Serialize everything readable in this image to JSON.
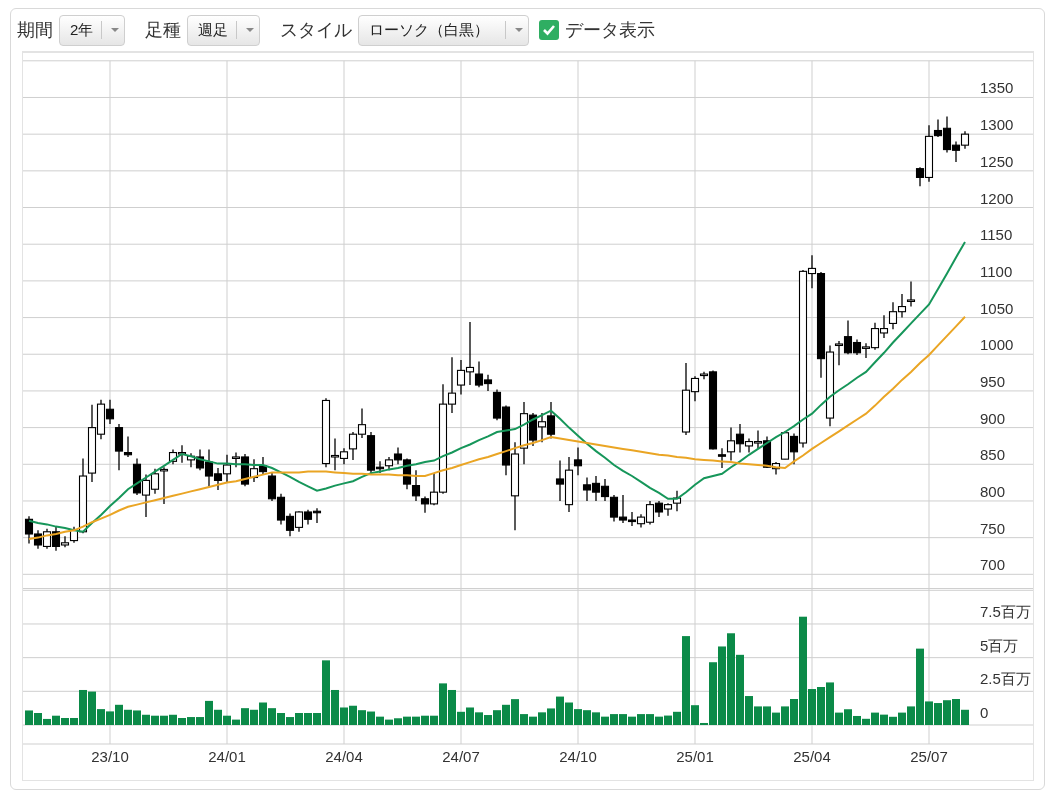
{
  "toolbar": {
    "fields": [
      {
        "label": "期間",
        "value": "2年"
      },
      {
        "label": "足種",
        "value": "週足"
      },
      {
        "label": "スタイル",
        "value": "ローソク（白黒）"
      }
    ],
    "data_display": {
      "label": "データ表示",
      "checked": true
    }
  },
  "price_chart": {
    "chart_data": {
      "type": "candlestick",
      "grid": true,
      "ylim": [
        680,
        1412
      ],
      "categories": [
        null,
        null,
        null,
        null,
        null,
        null,
        null,
        null,
        null,
        null,
        null,
        null,
        null,
        null,
        null,
        null,
        null,
        null,
        null,
        null,
        null,
        null,
        null,
        null,
        null,
        null,
        null,
        null,
        null,
        null,
        null,
        null,
        null,
        null,
        null,
        null,
        null,
        null,
        null,
        null,
        null,
        null,
        null,
        null,
        null,
        null,
        null,
        null,
        null,
        null,
        null,
        null,
        null,
        null,
        null,
        null,
        null,
        null,
        null,
        null,
        null,
        null,
        null,
        null,
        null,
        null,
        null,
        null,
        null,
        null,
        null,
        null,
        null,
        null,
        null,
        null,
        null,
        null,
        null,
        null,
        null,
        null,
        null,
        null,
        null,
        null,
        null,
        null,
        null,
        null,
        null,
        null,
        null,
        null,
        null,
        null,
        null,
        null,
        null,
        null,
        null,
        null,
        null,
        null,
        null
      ],
      "yticks": [
        700,
        750,
        800,
        850,
        900,
        950,
        1000,
        1050,
        1100,
        1150,
        1200,
        1250,
        1300,
        1350
      ],
      "ohlc": [
        [
          775,
          779,
          742,
          755
        ],
        [
          755,
          760,
          735,
          740
        ],
        [
          738,
          762,
          735,
          758
        ],
        [
          758,
          765,
          732,
          738
        ],
        [
          740,
          752,
          737,
          743
        ],
        [
          746,
          765,
          743,
          760
        ],
        [
          758,
          858,
          756,
          834
        ],
        [
          838,
          931,
          826,
          900
        ],
        [
          891,
          938,
          884,
          932
        ],
        [
          925,
          938,
          905,
          912
        ],
        [
          900,
          905,
          842,
          868
        ],
        [
          866,
          888,
          860,
          863
        ],
        [
          850,
          858,
          808,
          811
        ],
        [
          808,
          836,
          778,
          828
        ],
        [
          816,
          844,
          810,
          837
        ],
        [
          842,
          846,
          796,
          843
        ],
        [
          854,
          870,
          850,
          866
        ],
        [
          865,
          876,
          852,
          866
        ],
        [
          856,
          865,
          846,
          861
        ],
        [
          860,
          870,
          842,
          845
        ],
        [
          853,
          870,
          820,
          834
        ],
        [
          837,
          845,
          815,
          828
        ],
        [
          837,
          863,
          826,
          849
        ],
        [
          859,
          866,
          846,
          860
        ],
        [
          860,
          864,
          820,
          823
        ],
        [
          832,
          857,
          826,
          844
        ],
        [
          848,
          860,
          836,
          840
        ],
        [
          834,
          838,
          800,
          803
        ],
        [
          805,
          810,
          768,
          774
        ],
        [
          779,
          783,
          752,
          760
        ],
        [
          764,
          786,
          758,
          785
        ],
        [
          785,
          788,
          768,
          775
        ],
        [
          786,
          790,
          770,
          785
        ],
        [
          851,
          940,
          846,
          937
        ],
        [
          860,
          885,
          842,
          862
        ],
        [
          858,
          872,
          850,
          867
        ],
        [
          871,
          894,
          856,
          891
        ],
        [
          891,
          926,
          886,
          904
        ],
        [
          889,
          894,
          836,
          842
        ],
        [
          846,
          854,
          838,
          845
        ],
        [
          848,
          860,
          842,
          856
        ],
        [
          864,
          873,
          850,
          856
        ],
        [
          856,
          858,
          816,
          823
        ],
        [
          821,
          842,
          800,
          807
        ],
        [
          803,
          806,
          784,
          796
        ],
        [
          796,
          838,
          794,
          812
        ],
        [
          812,
          959,
          810,
          932
        ],
        [
          932,
          996,
          920,
          947
        ],
        [
          958,
          992,
          945,
          978
        ],
        [
          976,
          1044,
          958,
          982
        ],
        [
          973,
          990,
          955,
          958
        ],
        [
          965,
          972,
          950,
          960
        ],
        [
          948,
          952,
          910,
          913
        ],
        [
          928,
          930,
          835,
          849
        ],
        [
          807,
          880,
          760,
          864
        ],
        [
          872,
          935,
          850,
          919
        ],
        [
          917,
          920,
          875,
          883
        ],
        [
          901,
          920,
          880,
          908
        ],
        [
          916,
          935,
          885,
          891
        ],
        [
          830,
          855,
          800,
          823
        ],
        [
          795,
          860,
          785,
          842
        ],
        [
          856,
          873,
          835,
          848
        ],
        [
          822,
          832,
          800,
          815
        ],
        [
          824,
          834,
          800,
          812
        ],
        [
          820,
          830,
          800,
          806
        ],
        [
          805,
          808,
          772,
          778
        ],
        [
          778,
          808,
          770,
          774
        ],
        [
          774,
          785,
          766,
          773
        ],
        [
          769,
          782,
          764,
          778
        ],
        [
          771,
          800,
          768,
          795
        ],
        [
          797,
          800,
          778,
          785
        ],
        [
          789,
          797,
          780,
          795
        ],
        [
          797,
          814,
          786,
          804
        ],
        [
          894,
          988,
          890,
          951
        ],
        [
          949,
          970,
          936,
          967
        ],
        [
          971,
          976,
          966,
          973
        ],
        [
          976,
          978,
          870,
          871
        ],
        [
          863,
          872,
          845,
          862
        ],
        [
          867,
          900,
          855,
          882
        ],
        [
          891,
          905,
          866,
          878
        ],
        [
          875,
          885,
          866,
          881
        ],
        [
          880,
          896,
          872,
          881
        ],
        [
          882,
          888,
          845,
          846
        ],
        [
          844,
          853,
          836,
          851
        ],
        [
          857,
          895,
          857,
          893
        ],
        [
          888,
          892,
          850,
          867
        ],
        [
          879,
          1115,
          873,
          1113
        ],
        [
          1110,
          1135,
          1090,
          1117
        ],
        [
          1110,
          1112,
          968,
          994
        ],
        [
          913,
          1012,
          902,
          1003
        ],
        [
          1012,
          1018,
          985,
          1014
        ],
        [
          1024,
          1046,
          1000,
          1002
        ],
        [
          1016,
          1020,
          999,
          1002
        ],
        [
          1010,
          1015,
          995,
          1010
        ],
        [
          1009,
          1043,
          1006,
          1035
        ],
        [
          1029,
          1053,
          1022,
          1035
        ],
        [
          1042,
          1071,
          1034,
          1058
        ],
        [
          1058,
          1082,
          1050,
          1065
        ],
        [
          1073,
          1099,
          1065,
          1074
        ],
        [
          1253,
          1255,
          1229,
          1241
        ],
        [
          1241,
          1312,
          1235,
          1297
        ],
        [
          1305,
          1320,
          1296,
          1298
        ],
        [
          1308,
          1324,
          1275,
          1279
        ],
        [
          1285,
          1290,
          1262,
          1278
        ],
        [
          1285,
          1304,
          1280,
          1300
        ]
      ]
    }
  },
  "moving_averages": {
    "chart_data": {
      "type": "line",
      "ylim": [
        680,
        1412
      ],
      "categories": [
        null,
        null,
        null,
        null,
        null,
        null,
        null,
        null,
        null,
        null,
        null,
        null,
        null,
        null,
        null,
        null,
        null,
        null,
        null,
        null,
        null,
        null,
        null,
        null,
        null,
        null,
        null,
        null,
        null,
        null,
        null,
        null,
        null,
        null,
        null,
        null,
        null,
        null,
        null,
        null,
        null,
        null,
        null,
        null,
        null,
        null,
        null,
        null,
        null,
        null,
        null,
        null,
        null,
        null,
        null,
        null,
        null,
        null,
        null,
        null,
        null,
        null,
        null,
        null,
        null,
        null,
        null,
        null,
        null,
        null,
        null,
        null,
        null,
        null,
        null,
        null,
        null,
        null,
        null,
        null,
        null,
        null,
        null,
        null,
        null,
        null,
        null,
        null,
        null,
        null,
        null,
        null,
        null,
        null,
        null,
        null,
        null,
        null,
        null,
        null,
        null,
        null,
        null,
        null,
        null
      ],
      "series": [
        {
          "color": "#16965a",
          "values": [
            773,
            770,
            768,
            765,
            763,
            760,
            758,
            770,
            781,
            793,
            804,
            816,
            824,
            832,
            840,
            848,
            856,
            864,
            861,
            857,
            854,
            851,
            851,
            850,
            850,
            849,
            849,
            845,
            839,
            833,
            826,
            820,
            814,
            817,
            821,
            824,
            827,
            833,
            838,
            840,
            843,
            845,
            848,
            850,
            853,
            855,
            861,
            866,
            872,
            877,
            883,
            888,
            894,
            896,
            898,
            904,
            911,
            917,
            923,
            912,
            900,
            889,
            878,
            868,
            859,
            849,
            841,
            834,
            826,
            818,
            811,
            803,
            803,
            812,
            822,
            831,
            834,
            837,
            846,
            854,
            863,
            871,
            879,
            887,
            894,
            902,
            911,
            919,
            931,
            942,
            951,
            959,
            968,
            976,
            989,
            1002,
            1016,
            1029,
            1042,
            1055,
            1068,
            1089,
            1110,
            1132,
            1153
          ]
        },
        {
          "color": "#eaa524",
          "values": [
            748,
            750,
            753,
            755,
            758,
            760,
            765,
            771,
            776,
            781,
            787,
            792,
            795,
            798,
            801,
            804,
            807,
            810,
            813,
            816,
            819,
            822,
            825,
            827,
            830,
            833,
            836,
            839,
            839,
            839,
            839,
            840,
            840,
            840,
            839,
            838,
            837,
            837,
            836,
            836,
            836,
            835,
            835,
            834,
            834,
            838,
            842,
            845,
            849,
            853,
            857,
            860,
            864,
            868,
            872,
            876,
            879,
            883,
            887,
            885,
            883,
            881,
            879,
            877,
            875,
            873,
            871,
            869,
            867,
            865,
            863,
            862,
            860,
            859,
            857,
            856,
            855,
            854,
            853,
            851,
            850,
            849,
            848,
            846,
            845,
            854,
            862,
            871,
            879,
            887,
            895,
            903,
            911,
            919,
            930,
            942,
            953,
            965,
            976,
            988,
            999,
            1012,
            1025,
            1038,
            1051
          ]
        }
      ]
    }
  },
  "volume_chart": {
    "chart_data": {
      "type": "bar",
      "grid": true,
      "ylim": [
        0,
        10
      ],
      "categories": [
        null,
        null,
        null,
        null,
        null,
        null,
        null,
        null,
        null,
        "23/10",
        null,
        null,
        null,
        null,
        null,
        null,
        null,
        null,
        null,
        null,
        null,
        null,
        "24/01",
        null,
        null,
        null,
        null,
        null,
        null,
        null,
        null,
        null,
        null,
        null,
        null,
        "24/04",
        null,
        null,
        null,
        null,
        null,
        null,
        null,
        null,
        null,
        null,
        null,
        null,
        "24/07",
        null,
        null,
        null,
        null,
        null,
        null,
        null,
        null,
        null,
        null,
        null,
        null,
        "24/10",
        null,
        null,
        null,
        null,
        null,
        null,
        null,
        null,
        null,
        null,
        null,
        null,
        "25/01",
        null,
        null,
        null,
        null,
        null,
        null,
        null,
        null,
        null,
        null,
        null,
        null,
        "25/04",
        null,
        null,
        null,
        null,
        null,
        null,
        null,
        null,
        null,
        null,
        null,
        null,
        "25/07",
        null,
        null,
        null,
        null
      ],
      "yticks": [
        {
          "value": 0,
          "label": "0"
        },
        {
          "value": 2.5,
          "label": "2.5百万"
        },
        {
          "value": 5,
          "label": "5百万"
        },
        {
          "value": 7.5,
          "label": "7.5百万"
        }
      ],
      "series": [
        {
          "color": "#0b8a48",
          "values": [
            1.08,
            0.89,
            0.45,
            0.69,
            0.52,
            0.52,
            2.6,
            2.48,
            1.18,
            1.01,
            1.5,
            1.13,
            1.08,
            0.76,
            0.69,
            0.69,
            0.76,
            0.52,
            0.59,
            0.59,
            1.79,
            1.13,
            0.69,
            0.4,
            1.25,
            1.13,
            1.67,
            1.25,
            0.89,
            0.59,
            0.89,
            0.89,
            0.89,
            4.8,
            2.6,
            1.3,
            1.43,
            1.1,
            1.0,
            0.62,
            0.4,
            0.5,
            0.62,
            0.62,
            0.69,
            0.69,
            3.09,
            2.6,
            0.98,
            1.3,
            0.94,
            0.74,
            1.1,
            1.5,
            1.92,
            0.81,
            0.62,
            0.94,
            1.23,
            2.11,
            1.67,
            1.18,
            1.1,
            0.94,
            0.62,
            0.81,
            0.81,
            0.62,
            0.81,
            0.81,
            0.62,
            0.7,
            0.98,
            6.6,
            1.47,
            0.15,
            4.66,
            5.83,
            6.81,
            5.21,
            2.15,
            1.38,
            1.38,
            0.92,
            1.38,
            1.93,
            8.04,
            2.67,
            2.82,
            3.16,
            0.92,
            1.17,
            0.67,
            0.46,
            0.92,
            0.77,
            0.61,
            0.92,
            1.38,
            5.67,
            1.75,
            1.63,
            1.84,
            1.93,
            1.13
          ]
        }
      ]
    }
  }
}
